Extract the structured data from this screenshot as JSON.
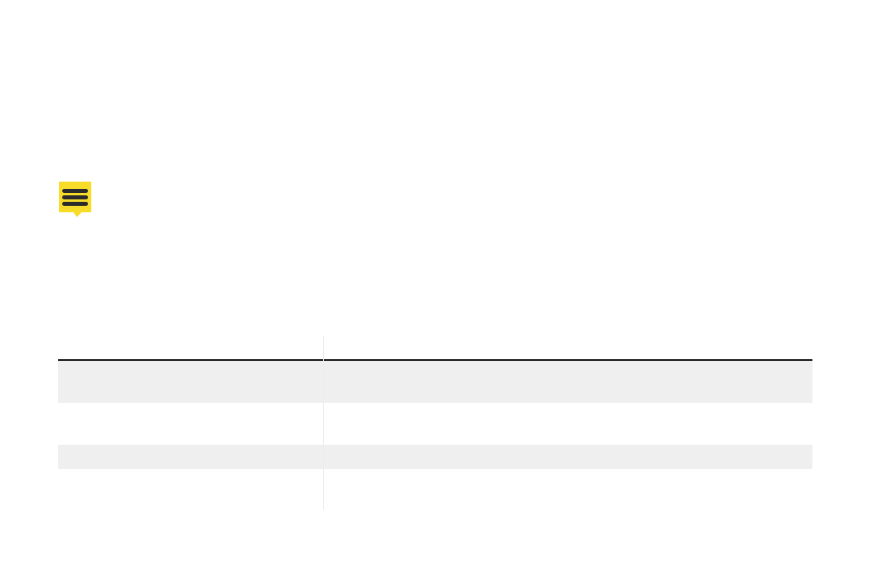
{
  "colors": {
    "note_icon_fill": "#F7DD2A",
    "note_icon_lines": "#2B2B2B",
    "row_shade": "#EFEFEF",
    "header_rule": "#111111"
  },
  "note": {
    "icon": "note-icon"
  },
  "table": {
    "headers": [
      "",
      ""
    ],
    "rows": [
      {
        "col1": "",
        "col2": "",
        "shaded": true
      },
      {
        "col1": "",
        "col2": "",
        "shaded": false
      },
      {
        "col1": "",
        "col2": "",
        "shaded": true
      },
      {
        "col1": "",
        "col2": "",
        "shaded": false
      }
    ]
  }
}
